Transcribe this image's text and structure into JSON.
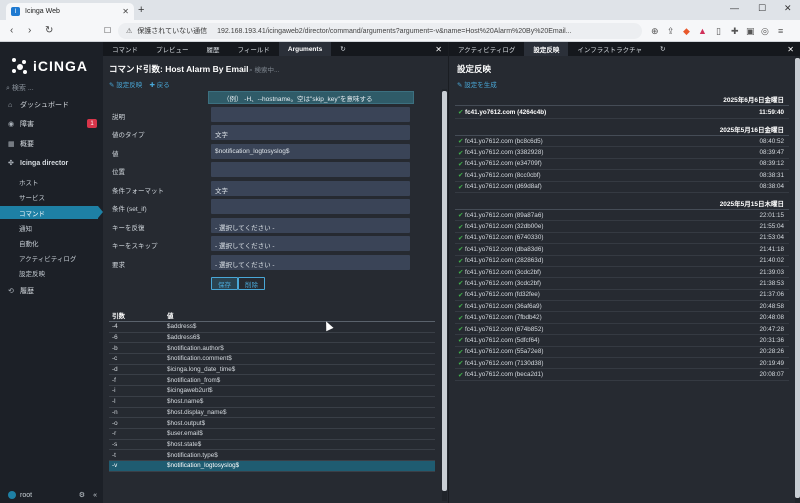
{
  "browser": {
    "tab_title": "Icinga Web",
    "insecure_label": "保護されていない通信",
    "url": "192.168.193.41/icingaweb2/director/command/arguments?argument=-v&name=Host%20Alarm%20By%20Email..."
  },
  "sidebar": {
    "logo_text": "iCINGA",
    "search_placeholder": "検索 ...",
    "items": [
      {
        "label": "ダッシュボード"
      },
      {
        "label": "障害",
        "badge": "1"
      },
      {
        "label": "概要"
      },
      {
        "label": "Icinga director"
      }
    ],
    "director_sub": [
      "ホスト",
      "サービス",
      "コマンド",
      "通知",
      "自動化",
      "アクティビティログ",
      "設定反映"
    ],
    "history_label": "履歴",
    "user": "root"
  },
  "left_panel": {
    "tabs": [
      "コマンド",
      "プレビュー",
      "履歴",
      "フィールド",
      "Arguments"
    ],
    "title": "コマンド引数: Host Alarm By Email",
    "search_placeholder": "検索中...",
    "deploy_action": "設定反映",
    "back_action": "戻る",
    "tooltip": "（例） -H、--hostname。空は\"skip_key\"を意味する",
    "form": [
      {
        "label": "説明",
        "value": ""
      },
      {
        "label": "値のタイプ",
        "value": "文字"
      },
      {
        "label": "値",
        "value": "$notification_logtosyslog$"
      },
      {
        "label": "位置",
        "value": ""
      },
      {
        "label": "条件フォーマット",
        "value": "文字"
      },
      {
        "label": "条件 (set_if)",
        "value": ""
      },
      {
        "label": "キーを反復",
        "value": "- 選択してください -"
      },
      {
        "label": "キーをスキップ",
        "value": "- 選択してください -"
      },
      {
        "label": "要求",
        "value": "- 選択してください -"
      }
    ],
    "save_label": "保存",
    "delete_label": "削除",
    "table_headers": [
      "引数",
      "値"
    ],
    "rows": [
      [
        "-4",
        "$address$"
      ],
      [
        "-6",
        "$address6$"
      ],
      [
        "-b",
        "$notification.author$"
      ],
      [
        "-c",
        "$notification.comment$"
      ],
      [
        "-d",
        "$icinga.long_date_time$"
      ],
      [
        "-f",
        "$notification_from$"
      ],
      [
        "-i",
        "$icingaweb2url$"
      ],
      [
        "-l",
        "$host.name$"
      ],
      [
        "-n",
        "$host.display_name$"
      ],
      [
        "-o",
        "$host.output$"
      ],
      [
        "-r",
        "$user.email$"
      ],
      [
        "-s",
        "$host.state$"
      ],
      [
        "-t",
        "$notification.type$"
      ],
      [
        "-v",
        "$notification_logtosyslog$"
      ]
    ],
    "selected_row": 13
  },
  "right_panel": {
    "tabs": [
      "アクティビティログ",
      "設定反映",
      "インフラストラクチャ"
    ],
    "title": "設定反映",
    "action": "設定を生成",
    "groups": [
      {
        "date": "2025年6月6日金曜日",
        "items": [
          {
            "name": "fc41.yo7612.com (4264c4b)",
            "time": "11:59:40",
            "strong": true
          }
        ]
      },
      {
        "date": "2025年5月16日金曜日",
        "items": [
          {
            "name": "fc41.yo7612.com (bc8c6d5)",
            "time": "08:40:52"
          },
          {
            "name": "fc41.yo7612.com (3382928)",
            "time": "08:39:47"
          },
          {
            "name": "fc41.yo7612.com (e34709f)",
            "time": "08:39:12"
          },
          {
            "name": "fc41.yo7612.com (8cc0cbf)",
            "time": "08:38:31"
          },
          {
            "name": "fc41.yo7612.com (d69d8af)",
            "time": "08:38:04"
          }
        ]
      },
      {
        "date": "2025年5月15日木曜日",
        "items": [
          {
            "name": "fc41.yo7612.com (89a87a6)",
            "time": "22:01:15"
          },
          {
            "name": "fc41.yo7612.com (32db00e)",
            "time": "21:55:04"
          },
          {
            "name": "fc41.yo7612.com (6740330)",
            "time": "21:53:04"
          },
          {
            "name": "fc41.yo7612.com (dba83d6)",
            "time": "21:41:18"
          },
          {
            "name": "fc41.yo7612.com (282863d)",
            "time": "21:40:02"
          },
          {
            "name": "fc41.yo7612.com (3cdc2bf)",
            "time": "21:39:03"
          },
          {
            "name": "fc41.yo7612.com (3cdc2bf)",
            "time": "21:38:53"
          },
          {
            "name": "fc41.yo7612.com (fd32fee)",
            "time": "21:37:06"
          },
          {
            "name": "fc41.yo7612.com (36af6a9)",
            "time": "20:48:58"
          },
          {
            "name": "fc41.yo7612.com (7fbdb42)",
            "time": "20:48:08"
          },
          {
            "name": "fc41.yo7612.com (674b852)",
            "time": "20:47:28"
          },
          {
            "name": "fc41.yo7612.com (5dfcf64)",
            "time": "20:31:36"
          },
          {
            "name": "fc41.yo7612.com (55a72e8)",
            "time": "20:28:26"
          },
          {
            "name": "fc41.yo7612.com (7130d38)",
            "time": "20:19:49"
          },
          {
            "name": "fc41.yo7612.com (beca2d1)",
            "time": "20:08:07"
          }
        ]
      }
    ]
  }
}
